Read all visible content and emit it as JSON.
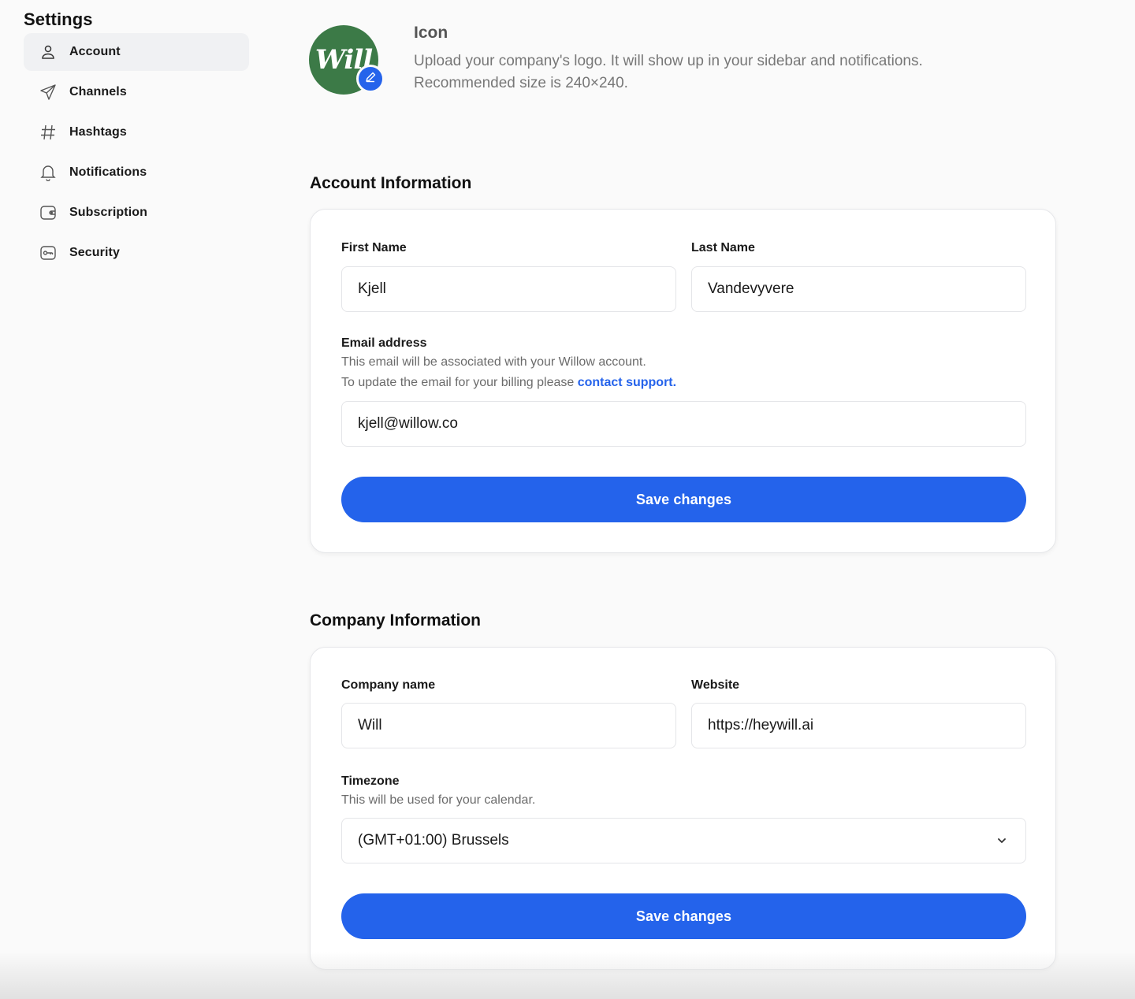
{
  "sidebar": {
    "title": "Settings",
    "items": [
      {
        "label": "Account",
        "icon": "user-icon",
        "active": true
      },
      {
        "label": "Channels",
        "icon": "send-icon"
      },
      {
        "label": "Hashtags",
        "icon": "hash-icon"
      },
      {
        "label": "Notifications",
        "icon": "bell-icon"
      },
      {
        "label": "Subscription",
        "icon": "wallet-icon"
      },
      {
        "label": "Security",
        "icon": "key-icon"
      }
    ]
  },
  "icon_section": {
    "logo_text": "Will",
    "heading": "Icon",
    "description": "Upload your company's logo. It will show up in your sidebar and notifications. Recommended size is 240×240."
  },
  "account": {
    "title": "Account Information",
    "first_name_label": "First Name",
    "first_name_value": "Kjell",
    "last_name_label": "Last Name",
    "last_name_value": "Vandevyvere",
    "email_label": "Email address",
    "email_help_1": "This email will be associated with your Willow account.",
    "email_help_2": "To update the email for your billing please ",
    "email_help_link": "contact support.",
    "email_value": "kjell@willow.co",
    "save_label": "Save changes"
  },
  "company": {
    "title": "Company Information",
    "company_name_label": "Company name",
    "company_name_value": "Will",
    "website_label": "Website",
    "website_value": "https://heywill.ai",
    "timezone_label": "Timezone",
    "timezone_help": "This will be used for your calendar.",
    "timezone_value": "(GMT+01:00) Brussels",
    "save_label": "Save changes"
  },
  "colors": {
    "accent": "#2463eb",
    "logo_bg": "#3c7a47"
  }
}
